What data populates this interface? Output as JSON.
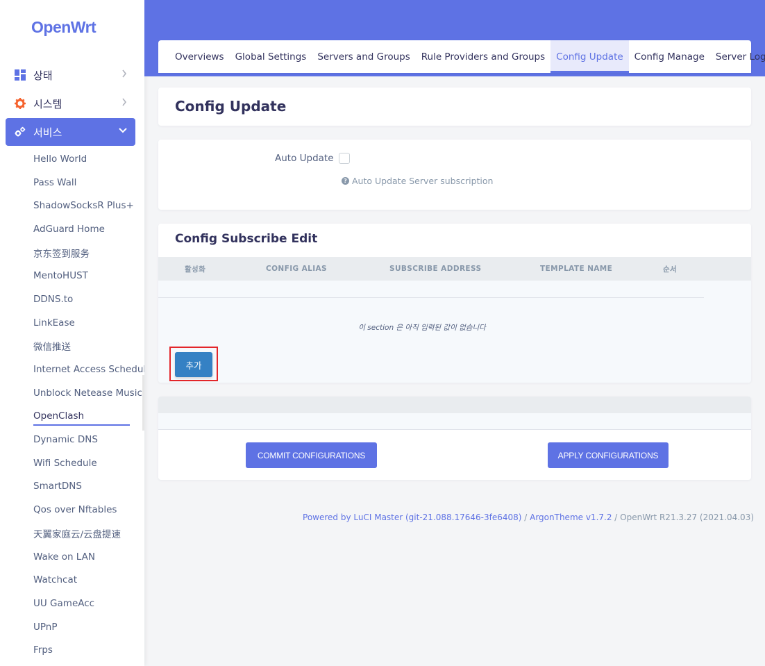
{
  "brand": {
    "logo": "OpenWrt",
    "accent": "#5e72e4"
  },
  "sidebar": {
    "menu": [
      {
        "label": "상태",
        "icon": "dashboard-icon",
        "expanded": false
      },
      {
        "label": "시스템",
        "icon": "gear-icon",
        "expanded": false
      },
      {
        "label": "서비스",
        "icon": "gears-icon",
        "expanded": true
      }
    ],
    "sub_items": [
      "Hello World",
      "Pass Wall",
      "ShadowSocksR Plus+",
      "AdGuard Home",
      "京东签到服务",
      "MentoHUST",
      "DDNS.to",
      "LinkEase",
      "微信推送",
      "Internet Access Schedule",
      "Unblock Netease Music",
      "OpenClash",
      "Dynamic DNS",
      "Wifi Schedule",
      "SmartDNS",
      "Qos over Nftables",
      "天翼家庭云/云盘提速",
      "Wake on LAN",
      "Watchcat",
      "UU GameAcc",
      "UPnP",
      "Frps"
    ],
    "current_sub_item": "OpenClash"
  },
  "tabs": [
    {
      "label": "Overviews",
      "active": false
    },
    {
      "label": "Global Settings",
      "active": false
    },
    {
      "label": "Servers and Groups",
      "active": false
    },
    {
      "label": "Rule Providers and Groups",
      "active": false
    },
    {
      "label": "Config Update",
      "active": true
    },
    {
      "label": "Config Manage",
      "active": false
    },
    {
      "label": "Server Logs",
      "active": false
    }
  ],
  "page": {
    "title": "Config Update",
    "auto_update": {
      "label": "Auto Update",
      "checked": false,
      "help": "Auto Update Server subscription"
    },
    "subscribe": {
      "title": "Config Subscribe Edit",
      "columns": [
        "활성화",
        "CONFIG ALIAS",
        "SUBSCRIBE ADDRESS",
        "TEMPLATE NAME",
        "순서"
      ],
      "empty_message": "이 section 은 아직 입력된 값이 없습니다",
      "add_label": "추가"
    },
    "actions": {
      "commit": "COMMIT CONFIGURATIONS",
      "apply": "APPLY CONFIGURATIONS"
    }
  },
  "footer": {
    "powered": "Powered by LuCI Master (git-21.088.17646-3fe6408)",
    "sep1": " / ",
    "theme": "ArgonTheme v1.7.2",
    "sep2": " / ",
    "version": "OpenWrt R21.3.27 (2021.04.03)"
  }
}
